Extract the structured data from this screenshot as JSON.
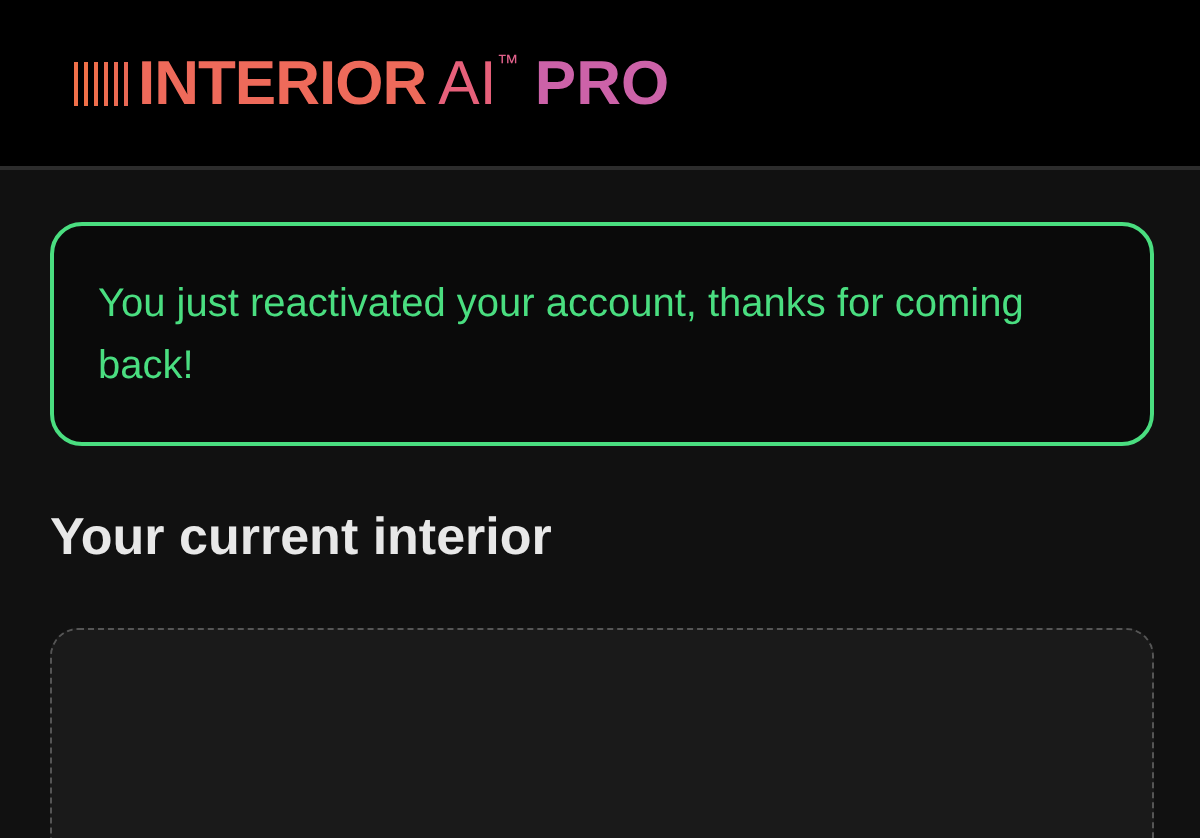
{
  "logo": {
    "name": "INTERIOR",
    "suffix": "AI",
    "mark": "™",
    "tier": "PRO"
  },
  "alert": {
    "kind": "success",
    "message": "You just reactivated your account, thanks for coming back!"
  },
  "section": {
    "title": "Your current interior"
  },
  "upload": {
    "kind": "dropzone"
  }
}
